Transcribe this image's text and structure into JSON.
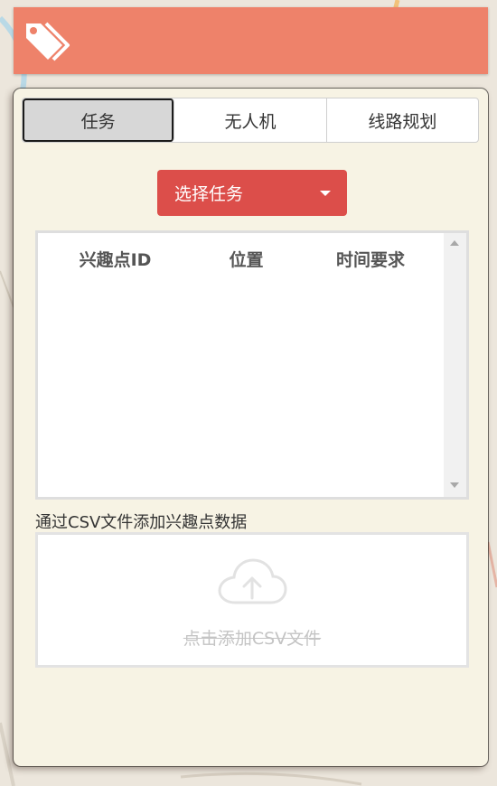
{
  "header": {
    "icon": "tags-icon",
    "color": "#ee826a"
  },
  "tabs": [
    {
      "label": "任务",
      "active": true
    },
    {
      "label": "无人机",
      "active": false
    },
    {
      "label": "线路规划",
      "active": false
    }
  ],
  "task_select": {
    "label": "选择任务",
    "color": "#dc4e4a"
  },
  "table": {
    "columns": [
      "兴趣点ID",
      "位置",
      "时间要求"
    ],
    "rows": []
  },
  "csv": {
    "label": "通过CSV文件添加兴趣点数据",
    "upload_text": "点击添加CSV文件",
    "icon": "cloud-upload-icon"
  }
}
